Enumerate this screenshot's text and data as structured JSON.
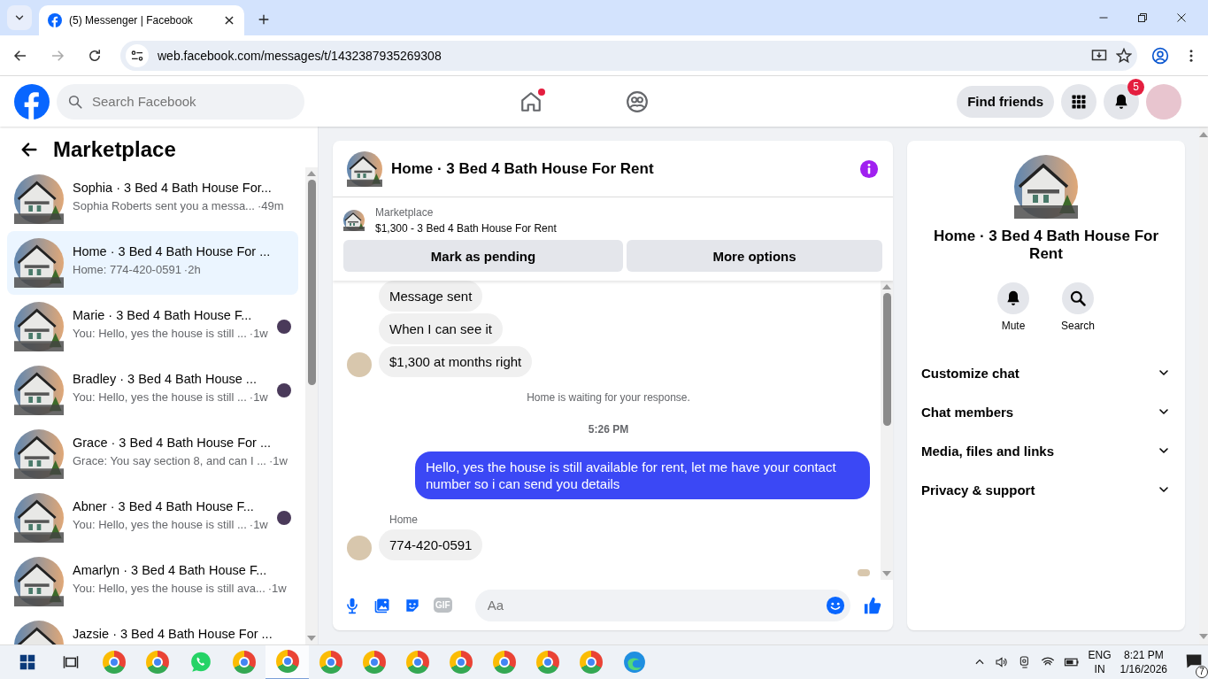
{
  "browser": {
    "tab_title": "(5) Messenger | Facebook",
    "url": "web.facebook.com/messages/t/1432387935269308"
  },
  "header": {
    "search_placeholder": "Search Facebook",
    "nav": [
      {
        "kind": "home",
        "dot": true
      },
      {
        "kind": "friends",
        "dot": false
      }
    ],
    "find_friends": "Find friends",
    "notification_count": "5"
  },
  "sidebar": {
    "title": "Marketplace",
    "conversations": [
      {
        "title": "Sophia · 3 Bed 4 Bath House For...",
        "preview": "Sophia Roberts sent you a messa...",
        "time": "·49m",
        "selected": false,
        "seen": false
      },
      {
        "title": "Home · 3 Bed 4 Bath House For ...",
        "preview": "Home: 774-420-0591",
        "time": "·2h",
        "selected": true,
        "seen": false
      },
      {
        "title": "Marie · 3 Bed 4 Bath House F...",
        "preview": "You: Hello, yes the house is still ...",
        "time": "·1w",
        "selected": false,
        "seen": true
      },
      {
        "title": "Bradley · 3 Bed 4 Bath House ...",
        "preview": "You: Hello, yes the house is still ...",
        "time": "·1w",
        "selected": false,
        "seen": true
      },
      {
        "title": "Grace · 3 Bed 4 Bath House For ...",
        "preview": "Grace: You say section 8, and can I ...",
        "time": "·1w",
        "selected": false,
        "seen": false
      },
      {
        "title": "Abner · 3 Bed 4 Bath House F...",
        "preview": "You: Hello, yes the house is still ...",
        "time": "·1w",
        "selected": false,
        "seen": true
      },
      {
        "title": "Amarlyn · 3 Bed 4 Bath House F...",
        "preview": "You: Hello, yes the house is still ava...",
        "time": "·1w",
        "selected": false,
        "seen": false
      },
      {
        "title": "Jazsie · 3 Bed 4 Bath House For ...",
        "selected": false,
        "seen": false
      }
    ]
  },
  "chat": {
    "title": "Home · 3 Bed 4 Bath House For Rent",
    "listing": {
      "label": "Marketplace",
      "text": "$1,300 - 3 Bed 4 Bath House For Rent"
    },
    "actions": [
      "Mark as pending",
      "More options"
    ],
    "messages": [
      {
        "kind": "incoming",
        "text": "Message sent",
        "avatar": false
      },
      {
        "kind": "incoming",
        "text": "When I can see it",
        "avatar": false
      },
      {
        "kind": "incoming",
        "text": "$1,300 at months right",
        "avatar": true
      },
      {
        "kind": "notice",
        "text": "Home is waiting for your response."
      },
      {
        "kind": "time",
        "text": "5:26 PM"
      },
      {
        "kind": "outgoing",
        "text": "Hello, yes the house is still available for rent, let me have your contact number so i can send you  details"
      },
      {
        "kind": "sender",
        "text": "Home"
      },
      {
        "kind": "incoming",
        "text": "774-420-0591",
        "avatar": true
      },
      {
        "kind": "receipt"
      }
    ],
    "composer": {
      "gif_label": "GIF",
      "placeholder": "Aa"
    }
  },
  "details": {
    "title": "Home · 3 Bed 4 Bath House For Rent",
    "actions": [
      {
        "kind": "mute",
        "label": "Mute"
      },
      {
        "kind": "search",
        "label": "Search"
      }
    ],
    "sections": [
      "Customize chat",
      "Chat members",
      "Media, files and links",
      "Privacy & support"
    ]
  },
  "taskbar": {
    "apps": [
      {
        "kind": "chrome",
        "selected": false
      },
      {
        "kind": "chrome",
        "selected": false
      },
      {
        "kind": "whatsapp",
        "selected": false
      },
      {
        "kind": "chrome",
        "selected": false
      },
      {
        "kind": "chrome",
        "selected": true
      },
      {
        "kind": "chrome",
        "selected": false
      },
      {
        "kind": "chrome",
        "selected": false
      },
      {
        "kind": "chrome",
        "selected": false
      },
      {
        "kind": "chrome",
        "selected": false
      },
      {
        "kind": "chrome",
        "selected": false
      },
      {
        "kind": "chrome",
        "selected": false
      },
      {
        "kind": "chrome",
        "selected": false
      },
      {
        "kind": "edge",
        "selected": false
      }
    ],
    "lang": "ENG",
    "region": "IN",
    "time": "8:21 PM",
    "date": "1/16/2026",
    "notification_count": "7"
  }
}
